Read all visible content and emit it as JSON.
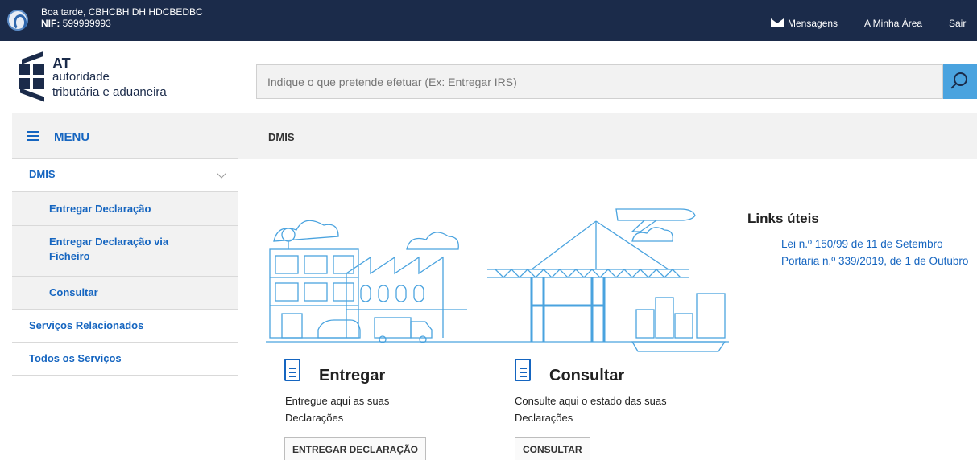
{
  "topbar": {
    "greeting": "Boa tarde, CBHCBH DH HDCBEDBC",
    "nif_label": "NIF:",
    "nif_value": "599999993",
    "links": [
      "Mensagens",
      "A Minha Área",
      "Sair"
    ]
  },
  "logo": {
    "line1": "AT",
    "line2": "autoridade",
    "line3": "tributária e aduaneira"
  },
  "search": {
    "placeholder": "Indique o que pretende efetuar (Ex: Entregar IRS)"
  },
  "sidebar": {
    "menu_label": "MENU",
    "items": [
      {
        "label": "DMIS"
      },
      {
        "label": "Entregar Declaração"
      },
      {
        "label": "Entregar Declaração via Ficheiro"
      },
      {
        "label": "Consultar"
      },
      {
        "label": "Serviços Relacionados"
      },
      {
        "label": "Todos os Serviços"
      }
    ]
  },
  "main": {
    "breadcrumb": "DMIS",
    "cards": [
      {
        "title": "Entregar",
        "desc_line1": "Entregue aqui as suas",
        "desc_line2": "Declarações",
        "button": "ENTREGAR DECLARAÇÃO"
      },
      {
        "title": "Consultar",
        "desc_line1": "Consulte aqui o estado das suas",
        "desc_line2": "Declarações",
        "button": "CONSULTAR"
      }
    ]
  },
  "links": {
    "title": "Links úteis",
    "items": [
      "Lei n.º 150/99 de 11 de Setembro",
      "Portaria n.º 339/2019, de 1 de Outubro"
    ]
  },
  "colors": {
    "topbar": "#1b2b4a",
    "accent": "#1565c0",
    "search_button": "#4aa3df",
    "illustration": "#4aa3df"
  }
}
